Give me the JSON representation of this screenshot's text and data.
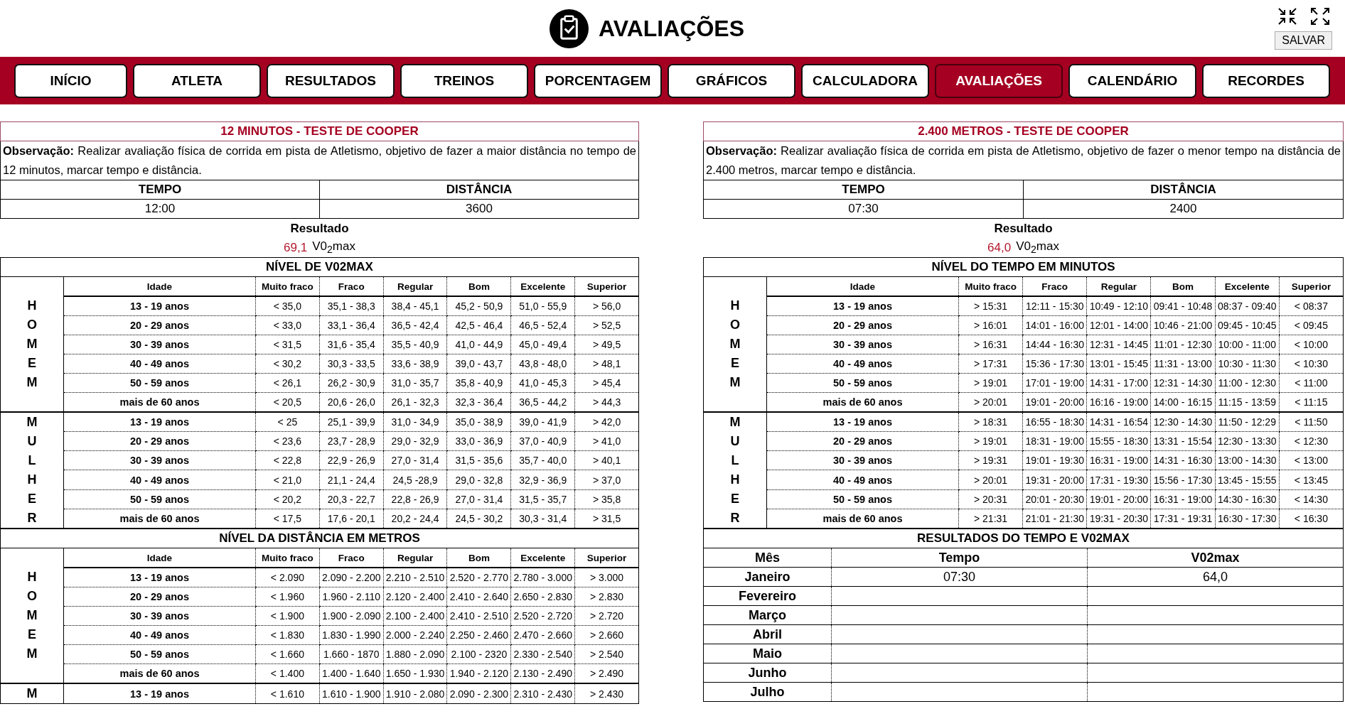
{
  "header": {
    "title": "AVALIAÇÕES",
    "save_button": "SALVAR"
  },
  "nav": {
    "tabs": [
      {
        "label": "INÍCIO",
        "selected": false
      },
      {
        "label": "ATLETA",
        "selected": false
      },
      {
        "label": "RESULTADOS",
        "selected": false
      },
      {
        "label": "TREINOS",
        "selected": false
      },
      {
        "label": "PORCENTAGEM",
        "selected": false
      },
      {
        "label": "GRÁFICOS",
        "selected": false
      },
      {
        "label": "CALCULADORA",
        "selected": false
      },
      {
        "label": "AVALIAÇÕES",
        "selected": true
      },
      {
        "label": "CALENDÁRIO",
        "selected": false
      },
      {
        "label": "RECORDES",
        "selected": false
      }
    ]
  },
  "panels": [
    {
      "title": "12 MINUTOS - TESTE DE COOPER",
      "note": "**Observação:** Realizar avaliação física de corrida em pista de Atletismo, objetivo de fazer a maior distância no tempo de 12 minutos, marcar tempo e distância.",
      "inputs": {
        "columns": [
          "TEMPO",
          "DISTÂNCIA"
        ],
        "values": [
          "12:00",
          "3600"
        ]
      },
      "result": {
        "label": "Resultado",
        "value": "69,1",
        "unit": "V0$_{2}$max"
      },
      "tables": [
        {
          "kind": "levels",
          "title": "NÍVEL DE V02MAX",
          "columns": [
            "Idade",
            "Muito fraco",
            "Fraco",
            "Regular",
            "Bom",
            "Excelente",
            "Superior"
          ],
          "groups": [
            {
              "label": "HOMEM",
              "rows": [
                [
                  "13 - 19 anos",
                  "< 35,0",
                  "35,1 - 38,3",
                  "38,4 - 45,1",
                  "45,2 - 50,9",
                  "51,0 - 55,9",
                  "> 56,0"
                ],
                [
                  "20 - 29 anos",
                  "< 33,0",
                  "33,1 - 36,4",
                  "36,5 - 42,4",
                  "42,5 - 46,4",
                  "46,5 - 52,4",
                  "> 52,5"
                ],
                [
                  "30 - 39 anos",
                  "< 31,5",
                  "31,6 - 35,4",
                  "35,5 - 40,9",
                  "41,0 - 44,9",
                  "45,0 - 49,4",
                  "> 49,5"
                ],
                [
                  "40 - 49 anos",
                  "< 30,2",
                  "30,3 - 33,5",
                  "33,6 - 38,9",
                  "39,0 - 43,7",
                  "43,8 - 48,0",
                  "> 48,1"
                ],
                [
                  "50 - 59 anos",
                  "< 26,1",
                  "26,2 - 30,9",
                  "31,0 - 35,7",
                  "35,8 - 40,9",
                  "41,0 - 45,3",
                  "> 45,4"
                ],
                [
                  "mais de 60 anos",
                  "< 20,5",
                  "20,6 - 26,0",
                  "26,1 - 32,3",
                  "32,3 - 36,4",
                  "36,5 - 44,2",
                  "> 44,3"
                ]
              ]
            },
            {
              "label": "MULHER",
              "rows": [
                [
                  "13 - 19 anos",
                  "< 25",
                  "25,1 - 39,9",
                  "31,0 - 34,9",
                  "35,0 - 38,9",
                  "39,0 - 41,9",
                  "> 42,0"
                ],
                [
                  "20 - 29 anos",
                  "< 23,6",
                  "23,7 - 28,9",
                  "29,0 - 32,9",
                  "33,0 - 36,9",
                  "37,0 - 40,9",
                  "> 41,0"
                ],
                [
                  "30 - 39 anos",
                  "< 22,8",
                  "22,9 - 26,9",
                  "27,0 - 31,4",
                  "31,5 - 35,6",
                  "35,7 - 40,0",
                  "> 40,1"
                ],
                [
                  "40 - 49 anos",
                  "< 21,0",
                  "21,1 - 24,4",
                  "24,5 -28,9",
                  "29,0 - 32,8",
                  "32,9 - 36,9",
                  "> 37,0"
                ],
                [
                  "50 - 59 anos",
                  "< 20,2",
                  "20,3 - 22,7",
                  "22,8 - 26,9",
                  "27,0 - 31,4",
                  "31,5 - 35,7",
                  "> 35,8"
                ],
                [
                  "mais de 60 anos",
                  "< 17,5",
                  "17,6 - 20,1",
                  "20,2 - 24,4",
                  "24,5 - 30,2",
                  "30,3 - 31,4",
                  "> 31,5"
                ]
              ]
            }
          ]
        },
        {
          "kind": "levels",
          "title": "NÍVEL DA DISTÂNCIA EM METROS",
          "columns": [
            "Idade",
            "Muito fraco",
            "Fraco",
            "Regular",
            "Bom",
            "Excelente",
            "Superior"
          ],
          "groups": [
            {
              "label": "HOMEM",
              "rows": [
                [
                  "13 - 19 anos",
                  "< 2.090",
                  "2.090 - 2.200",
                  "2.210 - 2.510",
                  "2.520 - 2.770",
                  "2.780 - 3.000",
                  "> 3.000"
                ],
                [
                  "20 - 29 anos",
                  "< 1.960",
                  "1.960 - 2.110",
                  "2.120 - 2.400",
                  "2.410 - 2.640",
                  "2.650 - 2.830",
                  "> 2.830"
                ],
                [
                  "30 - 39 anos",
                  "< 1.900",
                  "1.900 - 2.090",
                  "2.100 - 2.400",
                  "2.410 - 2.510",
                  "2.520 - 2.720",
                  "> 2.720"
                ],
                [
                  "40 - 49 anos",
                  "< 1.830",
                  "1.830 - 1.990",
                  "2.000 - 2.240",
                  "2.250 - 2.460",
                  "2.470 - 2.660",
                  "> 2.660"
                ],
                [
                  "50 - 59 anos",
                  "< 1.660",
                  "1.660 - 1870",
                  "1.880 - 2.090",
                  "2.100 - 2320",
                  "2.330 - 2.540",
                  "> 2.540"
                ],
                [
                  "mais de 60 anos",
                  "< 1.400",
                  "1.400 - 1.640",
                  "1.650 - 1.930",
                  "1.940 - 2.120",
                  "2.130 - 2.490",
                  "> 2.490"
                ]
              ]
            },
            {
              "label": "M",
              "rows": [
                [
                  "13 - 19 anos",
                  "< 1.610",
                  "1.610 - 1.900",
                  "1.910 - 2.080",
                  "2.090 - 2.300",
                  "2.310 - 2.430",
                  "> 2.430"
                ]
              ]
            }
          ]
        }
      ]
    },
    {
      "title": "2.400 METROS - TESTE DE COOPER",
      "note": "**Observação:** Realizar avaliação física de corrida em pista de Atletismo, objetivo de fazer o menor tempo na distância de 2.400 metros, marcar tempo e distância.",
      "inputs": {
        "columns": [
          "TEMPO",
          "DISTÂNCIA"
        ],
        "values": [
          "07:30",
          "2400"
        ]
      },
      "result": {
        "label": "Resultado",
        "value": "64,0",
        "unit": "V0$_{2}$max"
      },
      "tables": [
        {
          "kind": "levels",
          "title": "NÍVEL DO TEMPO EM MINUTOS",
          "columns": [
            "Idade",
            "Muito fraco",
            "Fraco",
            "Regular",
            "Bom",
            "Excelente",
            "Superior"
          ],
          "groups": [
            {
              "label": "HOMEM",
              "rows": [
                [
                  "13 - 19 anos",
                  "> 15:31",
                  "12:11 - 15:30",
                  "10:49 - 12:10",
                  "09:41 - 10:48",
                  "08:37 - 09:40",
                  "< 08:37"
                ],
                [
                  "20 - 29 anos",
                  "> 16:01",
                  "14:01 - 16:00",
                  "12:01 - 14:00",
                  "10:46 - 21:00",
                  "09:45 - 10:45",
                  "< 09:45"
                ],
                [
                  "30 - 39 anos",
                  "> 16:31",
                  "14:44 - 16:30",
                  "12:31 - 14:45",
                  "11:01 - 12:30",
                  "10:00 - 11:00",
                  "< 10:00"
                ],
                [
                  "40 - 49 anos",
                  "> 17:31",
                  "15:36 - 17:30",
                  "13:01 - 15:45",
                  "11:31 - 13:00",
                  "10:30 - 11:30",
                  "< 10:30"
                ],
                [
                  "50 - 59 anos",
                  "> 19:01",
                  "17:01 - 19:00",
                  "14:31 - 17:00",
                  "12:31 - 14:30",
                  "11:00 - 12:30",
                  "< 11:00"
                ],
                [
                  "mais de 60 anos",
                  "> 20:01",
                  "19:01 - 20:00",
                  "16:16 - 19:00",
                  "14:00 - 16:15",
                  "11:15 - 13:59",
                  "< 11:15"
                ]
              ]
            },
            {
              "label": "MULHER",
              "rows": [
                [
                  "13 - 19 anos",
                  "> 18:31",
                  "16:55 - 18:30",
                  "14:31 - 16:54",
                  "12:30 - 14:30",
                  "11:50 - 12:29",
                  "< 11:50"
                ],
                [
                  "20 - 29 anos",
                  "> 19:01",
                  "18:31 - 19:00",
                  "15:55 - 18:30",
                  "13:31 - 15:54",
                  "12:30 - 13:30",
                  "< 12:30"
                ],
                [
                  "30 - 39 anos",
                  "> 19:31",
                  "19:01 - 19:30",
                  "16:31 - 19:00",
                  "14:31 - 16:30",
                  "13:00 - 14:30",
                  "< 13:00"
                ],
                [
                  "40 - 49 anos",
                  "> 20:01",
                  "19:31 - 20:00",
                  "17:31 - 19:30",
                  "15:56 - 17:30",
                  "13:45 - 15:55",
                  "< 13:45"
                ],
                [
                  "50 - 59 anos",
                  "> 20:31",
                  "20:01 - 20:30",
                  "19:01 - 20:00",
                  "16:31 - 19:00",
                  "14:30 - 16:30",
                  "< 14:30"
                ],
                [
                  "mais de 60 anos",
                  "> 21:31",
                  "21:01 - 21:30",
                  "19:31 - 20:30",
                  "17:31 - 19:31",
                  "16:30 - 17:30",
                  "< 16:30"
                ]
              ]
            }
          ]
        },
        {
          "kind": "monthly",
          "title": "RESULTADOS DO TEMPO E V02MAX",
          "columns": [
            "Mês",
            "Tempo",
            "V02max"
          ],
          "rows": [
            [
              "Janeiro",
              "07:30",
              "64,0"
            ],
            [
              "Fevereiro"
            ],
            [
              "Março"
            ],
            [
              "Abril"
            ],
            [
              "Maio"
            ],
            [
              "Junho"
            ],
            [
              "Julho"
            ]
          ]
        }
      ]
    }
  ]
}
